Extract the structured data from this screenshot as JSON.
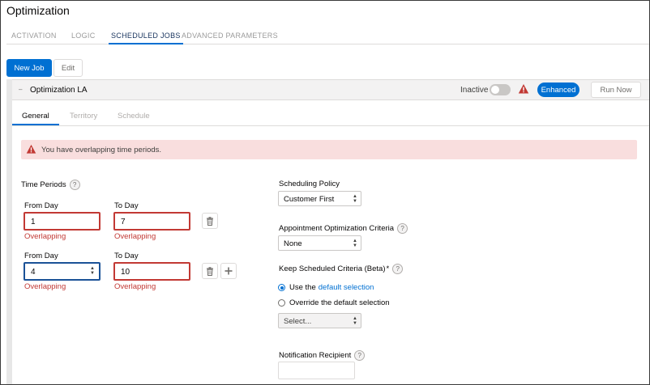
{
  "page": {
    "title": "Optimization"
  },
  "main_tabs": [
    {
      "label": "ACTIVATION"
    },
    {
      "label": "LOGIC"
    },
    {
      "label": "SCHEDULED JOBS",
      "active": true
    },
    {
      "label": "ADVANCED PARAMETERS"
    }
  ],
  "toolbar": {
    "new_job_label": "New Job",
    "edit_label": "Edit"
  },
  "job": {
    "name": "Optimization LA",
    "status_label": "Inactive",
    "active": false,
    "badge": "Enhanced",
    "run_now_label": "Run Now"
  },
  "sub_tabs": [
    {
      "label": "General",
      "active": true
    },
    {
      "label": "Territory"
    },
    {
      "label": "Schedule"
    }
  ],
  "alert": {
    "message": "You have overlapping time periods."
  },
  "time_periods": {
    "label": "Time Periods",
    "from_label": "From Day",
    "to_label": "To Day",
    "rows": [
      {
        "from": "1",
        "to": "7",
        "from_error": "Overlapping",
        "to_error": "Overlapping"
      },
      {
        "from": "4",
        "to": "10",
        "from_error": "Overlapping",
        "to_error": "Overlapping"
      }
    ]
  },
  "scheduling_policy": {
    "label": "Scheduling Policy",
    "value": "Customer First"
  },
  "appointment_criteria": {
    "label": "Appointment Optimization Criteria",
    "value": "None"
  },
  "keep_scheduled": {
    "label": "Keep Scheduled Criteria (Beta)",
    "required_mark": "*",
    "option_default_prefix": "Use the",
    "option_default_link": "default selection",
    "option_override": "Override the default selection",
    "select_placeholder": "Select..."
  },
  "notification": {
    "label": "Notification Recipient",
    "value": ""
  },
  "help_glyph": "?",
  "colors": {
    "brand": "#0070d2",
    "error": "#c23934",
    "alert_bg": "#f9dede"
  }
}
